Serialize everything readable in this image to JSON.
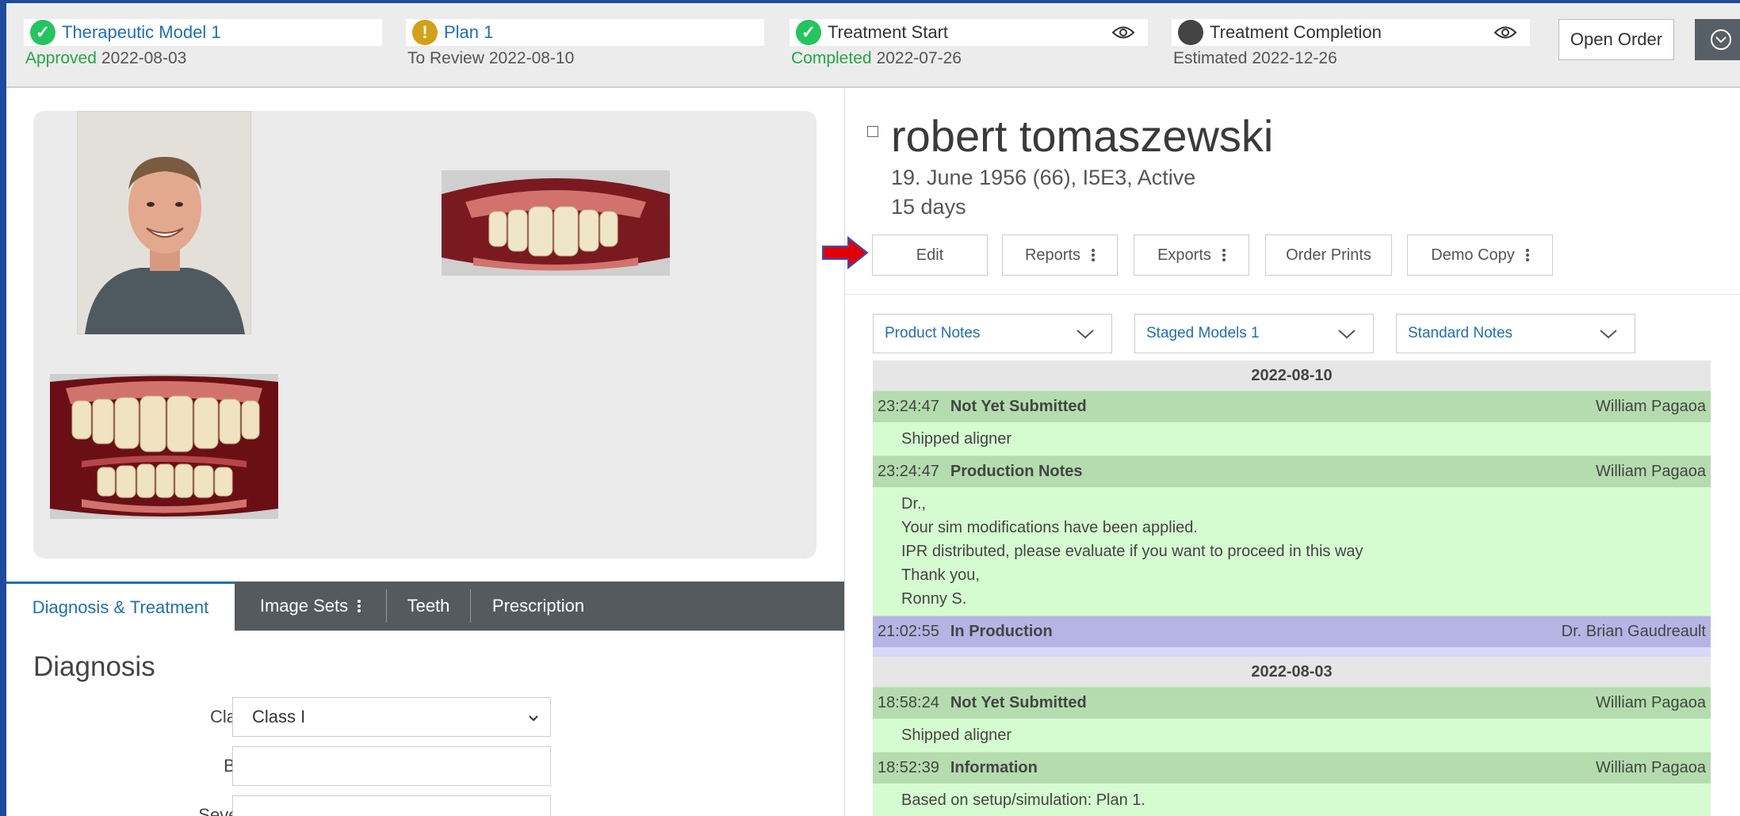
{
  "stages": [
    {
      "name": "Therapeutic Model 1",
      "status": "Approved",
      "date": "2022-08-03"
    },
    {
      "name": "Plan 1",
      "status": "To Review",
      "date": "2022-08-10"
    },
    {
      "name": "Treatment Start",
      "status": "Completed",
      "date": "2022-07-26"
    },
    {
      "name": "Treatment Completion",
      "status": "Estimated",
      "date": "2022-12-26"
    }
  ],
  "colors": {
    "accent": "#1f6fb5",
    "approved": "#22c55e",
    "review": "#d4a017",
    "note_green": "#b4dcae",
    "note_purple": "#b6b4e4"
  },
  "icons": {
    "check": "✓",
    "warning": "!",
    "eye": "eye-icon",
    "toggle": "chevron-circle-icon"
  },
  "open_order_label": "Open Order",
  "tabs": [
    "Diagnosis & Treatment",
    "Image Sets",
    "Teeth",
    "Prescription"
  ],
  "diagnosis": {
    "title": "Diagnosis",
    "fields": [
      {
        "label": "Class",
        "value": "Class I"
      },
      {
        "label": "Bite",
        "value": ""
      },
      {
        "label": "Severe",
        "value": ""
      }
    ]
  },
  "patient": {
    "name": "robert tomaszewski",
    "info": "19. June 1956  (66), I5E3, Active",
    "days": "15 days"
  },
  "actions": [
    "Edit",
    "Reports",
    "Exports",
    "Order Prints",
    "Demo Copy"
  ],
  "filters": [
    "Product Notes",
    "Staged Models 1",
    "Standard Notes"
  ],
  "notes": [
    {
      "date": "2022-08-10",
      "entries": [
        {
          "time": "23:24:47",
          "title": "Not Yet Submitted",
          "author": "William Pagaoa",
          "kind": "green",
          "lines": [
            "Shipped aligner"
          ]
        },
        {
          "time": "23:24:47",
          "title": "Production Notes",
          "author": "William Pagaoa",
          "kind": "green",
          "lines": [
            "Dr.,",
            "Your sim modifications have been applied.",
            "IPR distributed, please evaluate if you want to proceed in this way",
            "Thank you,",
            "Ronny S."
          ]
        },
        {
          "time": "21:02:55",
          "title": "In Production",
          "author": "Dr. Brian Gaudreault",
          "kind": "purple",
          "lines": []
        }
      ]
    },
    {
      "date": "2022-08-03",
      "entries": [
        {
          "time": "18:58:24",
          "title": "Not Yet Submitted",
          "author": "William Pagaoa",
          "kind": "green",
          "lines": [
            "Shipped aligner"
          ]
        },
        {
          "time": "18:52:39",
          "title": "Information",
          "author": "William Pagaoa",
          "kind": "green",
          "lines": [
            "Based on setup/simulation: Plan 1."
          ]
        }
      ]
    }
  ]
}
